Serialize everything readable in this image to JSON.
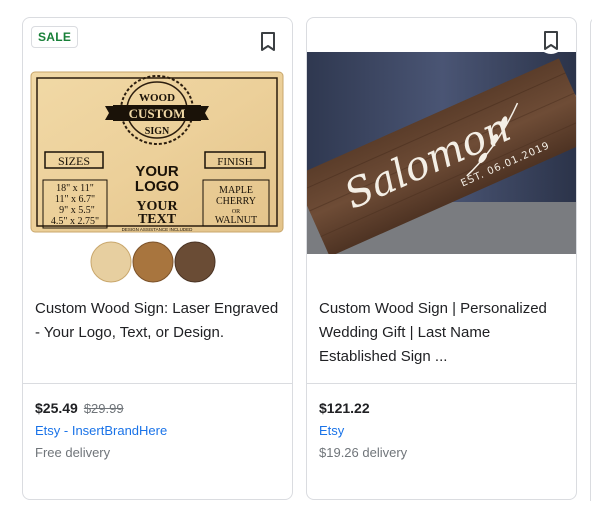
{
  "products": [
    {
      "badge": "SALE",
      "sign": {
        "top_word": "WOOD",
        "banner": "CUSTOM",
        "bottom_word": "SIGN",
        "sizes_label": "SIZES",
        "sizes": [
          "18\" x 11\"",
          "11\" x 6.7\"",
          "9\" x 5.5\"",
          "4.5\" x 2.75\""
        ],
        "logo_lines": [
          "YOUR",
          "LOGO",
          "YOUR",
          "TEXT"
        ],
        "assist": "DESIGN ASSISTANCE INCLUDED",
        "finish_label": "FINISH",
        "finishes": [
          "MAPLE",
          "CHERRY",
          "OR",
          "WALNUT"
        ]
      },
      "title": "Custom Wood Sign: Laser Engraved - Your Logo, Text, or Design.",
      "price": "$25.49",
      "old_price": "$29.99",
      "seller": "Etsy - InsertBrandHere",
      "delivery": "Free delivery"
    },
    {
      "sign": {
        "name": "Salomon",
        "est": "EST. 06.01.2019"
      },
      "title": "Custom Wood Sign | Personalized Wedding Gift | Last Name Established Sign ...",
      "price": "$121.22",
      "seller": "Etsy",
      "delivery": "$19.26 delivery"
    }
  ]
}
